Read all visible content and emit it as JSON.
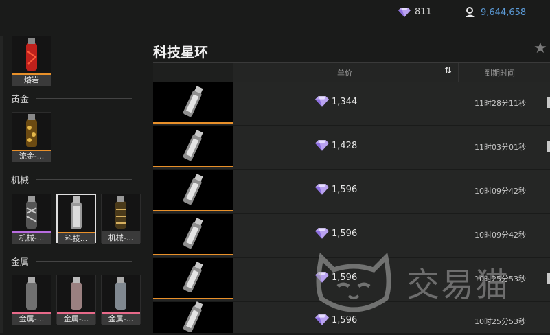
{
  "currency": {
    "gems": "811",
    "coins": "9,644,658"
  },
  "sidebar": {
    "top_item": {
      "label": "熔岩"
    },
    "categories": [
      {
        "name": "黄金",
        "items": [
          {
            "label": "流金-..."
          }
        ]
      },
      {
        "name": "机械",
        "items": [
          {
            "label": "机械-..."
          },
          {
            "label": "科技..."
          },
          {
            "label": "机械-..."
          }
        ]
      },
      {
        "name": "金属",
        "items": [
          {
            "label": "金属-..."
          },
          {
            "label": "金属-..."
          },
          {
            "label": "金属-..."
          }
        ]
      }
    ]
  },
  "listing": {
    "title": "科技星环",
    "columns": {
      "price": "单价",
      "expiry": "到期时间"
    },
    "rows": [
      {
        "price": "1,344",
        "time": "11时28分11秒"
      },
      {
        "price": "1,428",
        "time": "11时03分01秒"
      },
      {
        "price": "1,596",
        "time": "10时09分42秒"
      },
      {
        "price": "1,596",
        "time": "10时09分42秒"
      },
      {
        "price": "1,596",
        "time": "10时25分53秒"
      },
      {
        "price": "1,596",
        "time": "10时25分53秒"
      }
    ]
  },
  "watermark": "交易猫",
  "colors": {
    "accent_orange": "#e8902a",
    "coin_blue": "#5b9bd8",
    "rarity_purple": "#b86de0",
    "rarity_pink": "#e86a8a"
  },
  "icons": [
    "gem-icon",
    "coin-icon",
    "star-icon",
    "sort-icon"
  ]
}
